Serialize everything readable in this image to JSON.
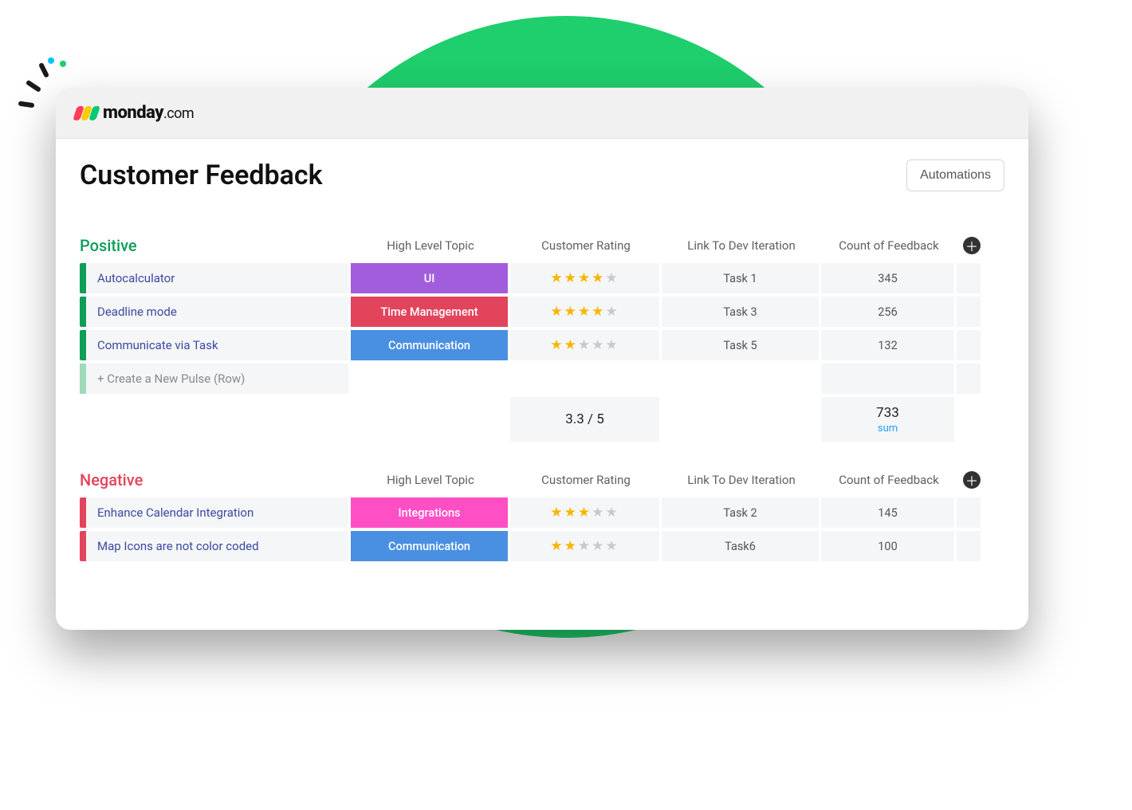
{
  "logo": {
    "text": "monday",
    "suffix": ".com"
  },
  "page": {
    "title": "Customer Feedback",
    "automations_label": "Automations"
  },
  "columns": {
    "topic": "High Level Topic",
    "rating": "Customer Rating",
    "link": "Link To Dev Iteration",
    "count": "Count of Feedback"
  },
  "new_pulse_label": "+ Create a New Pulse (Row)",
  "groups": [
    {
      "key": "positive",
      "title": "Positive",
      "rows": [
        {
          "name": "Autocalculator",
          "topic": "UI",
          "topic_class": "tag-ui",
          "rating": 4,
          "link": "Task 1",
          "count": "345"
        },
        {
          "name": "Deadline mode",
          "topic": "Time Management",
          "topic_class": "tag-time",
          "rating": 4,
          "link": "Task 3",
          "count": "256"
        },
        {
          "name": "Communicate via Task",
          "topic": "Communication",
          "topic_class": "tag-comm",
          "rating": 2,
          "link": "Task 5",
          "count": "132"
        }
      ],
      "summary": {
        "rating": "3.3 / 5",
        "count": "733",
        "count_label": "sum"
      }
    },
    {
      "key": "negative",
      "title": "Negative",
      "rows": [
        {
          "name": "Enhance Calendar Integration",
          "topic": "Integrations",
          "topic_class": "tag-integr",
          "rating": 3,
          "link": "Task 2",
          "count": "145"
        },
        {
          "name": "Map Icons are not color coded",
          "topic": "Communication",
          "topic_class": "tag-comm",
          "rating": 2,
          "link": "Task6",
          "count": "100"
        }
      ]
    }
  ]
}
